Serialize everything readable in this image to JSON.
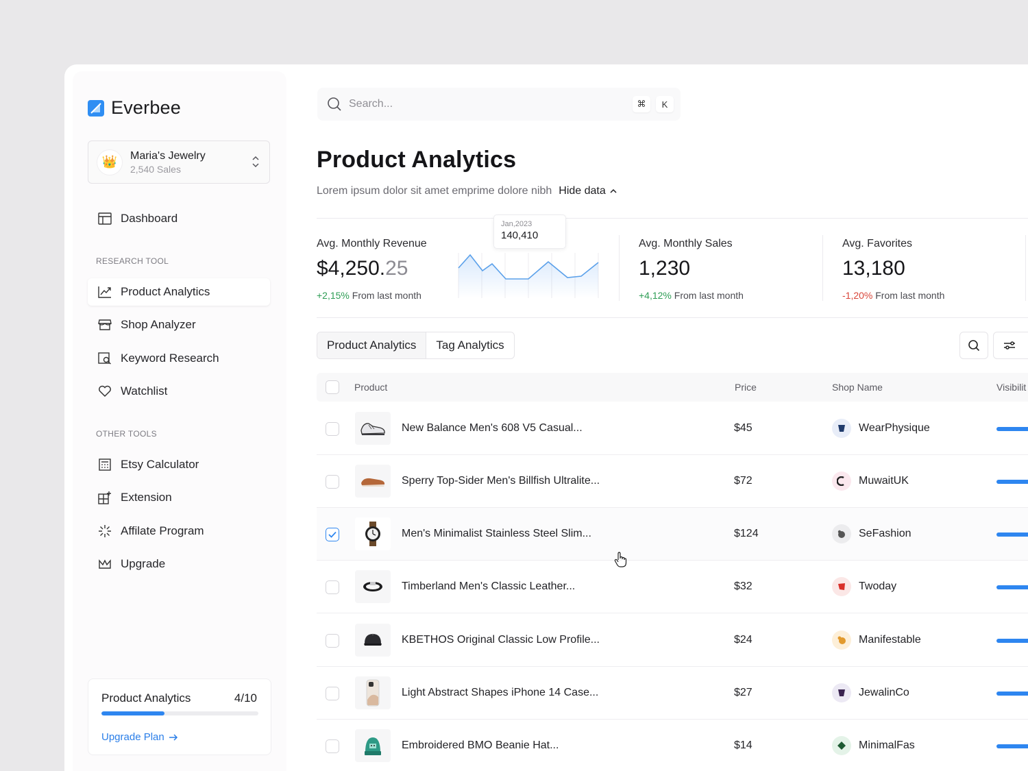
{
  "brand": {
    "name": "Everbee"
  },
  "shop": {
    "name": "Maria's Jewelry",
    "sales": "2,540 Sales",
    "avatar": "👑"
  },
  "nav": {
    "dashboard": "Dashboard",
    "research_label": "RESEARCH TOOL",
    "research": [
      "Product Analytics",
      "Shop Analyzer",
      "Keyword Research",
      "Watchlist"
    ],
    "other_label": "OTHER TOOLS",
    "other": [
      "Etsy Calculator",
      "Extension",
      "Affilate Program",
      "Upgrade"
    ]
  },
  "usage": {
    "title": "Product Analytics",
    "count": "4/10",
    "progress": 0.4,
    "link": "Upgrade Plan"
  },
  "search": {
    "placeholder": "Search...",
    "key1": "⌘",
    "key2": "K"
  },
  "page": {
    "title": "Product Analytics",
    "subtitle": "Lorem ipsum dolor sit amet emprime dolore nibh",
    "hide_data": "Hide data"
  },
  "stats": {
    "revenue": {
      "label": "Avg. Monthly Revenue",
      "value_main": "$4,250.",
      "value_dec": "25",
      "delta": "+2,15%",
      "delta_text": "From last month"
    },
    "sales": {
      "label": "Avg. Monthly Sales",
      "value": "1,230",
      "delta": "+4,12%",
      "delta_text": "From last month"
    },
    "favorites": {
      "label": "Avg. Favorites",
      "value": "13,180",
      "delta": "-1,20%",
      "delta_text": "From last month"
    },
    "tooltip": {
      "date": "Jan,2023",
      "value": "140,410"
    }
  },
  "tabs": [
    "Product Analytics",
    "Tag Analytics"
  ],
  "table": {
    "headers": {
      "product": "Product",
      "price": "Price",
      "shop": "Shop Name",
      "visibility": "Visibilit"
    },
    "rows": [
      {
        "product": "New Balance Men's 608 V5 Casual...",
        "price": "$45",
        "shop": "WearPhysique",
        "checked": false
      },
      {
        "product": "Sperry Top-Sider Men's Billfish Ultralite...",
        "price": "$72",
        "shop": "MuwaitUK",
        "checked": false
      },
      {
        "product": "Men's Minimalist Stainless Steel Slim...",
        "price": "$124",
        "shop": "SeFashion",
        "checked": true
      },
      {
        "product": "Timberland Men's Classic Leather...",
        "price": "$32",
        "shop": "Twoday",
        "checked": false
      },
      {
        "product": "KBETHOS Original Classic Low Profile...",
        "price": "$24",
        "shop": "Manifestable",
        "checked": false
      },
      {
        "product": "Light Abstract Shapes iPhone 14 Case...",
        "price": "$27",
        "shop": "JewalinCo",
        "checked": false
      },
      {
        "product": "Embroidered BMO Beanie Hat...",
        "price": "$14",
        "shop": "MinimalFas",
        "checked": false
      }
    ]
  },
  "colors": {
    "accent": "#2e86f0",
    "positive": "#2e9d55",
    "negative": "#d9463a"
  }
}
